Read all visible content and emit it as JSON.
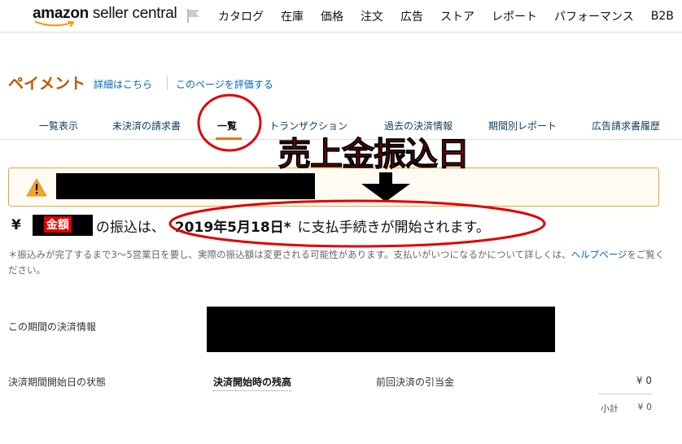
{
  "header": {
    "logo_main": "amazon",
    "logo_rest": " seller central",
    "flag_icon": "flag-icon",
    "nav": [
      "カタログ",
      "在庫",
      "価格",
      "注文",
      "広告",
      "ストア",
      "レポート",
      "パフォーマンス",
      "B2B"
    ]
  },
  "page": {
    "title": "ペイメント",
    "details_link": "詳細はこちら",
    "rate_link": "このページを評価する"
  },
  "tabs": [
    {
      "label": "一覧表示",
      "active": false
    },
    {
      "label": "未決済の請求書",
      "active": false
    },
    {
      "label": "一覧",
      "active": true
    },
    {
      "label": "トランザクション",
      "active": false
    },
    {
      "label": "過去の決済情報",
      "active": false
    },
    {
      "label": "期間別レポート",
      "active": false
    },
    {
      "label": "広告請求書履歴",
      "active": false
    }
  ],
  "alert": {
    "icon": "warning-icon"
  },
  "annotation": {
    "title": "売上金振込日",
    "amount_label": "金額"
  },
  "payment": {
    "yen": "¥",
    "prefix": "の振込は、",
    "date": "2019年5月18日*",
    "suffix": "に支払手続きが開始されます。",
    "note": "＊振込みが完了するまで3〜5営業日を要し、実際の振込額は変更される可能性があります。支払いがいつになるかについて詳しくは、",
    "note_link": "ヘルプページ",
    "note_end": "をご覧ください。"
  },
  "settlement": {
    "period_label": "この期間の決済情報",
    "start_label": "決済期間開始日の状態",
    "begin_balance": "決済開始時の残高",
    "prev_label": "前回決済の引当金",
    "prev_value": "¥ 0",
    "subtotal_label": "小計",
    "subtotal_value": "¥ 0"
  },
  "colors": {
    "accent": "#c45500",
    "link": "#0066c0",
    "annotation": "#e00000",
    "alert_border": "#e8a33c"
  }
}
